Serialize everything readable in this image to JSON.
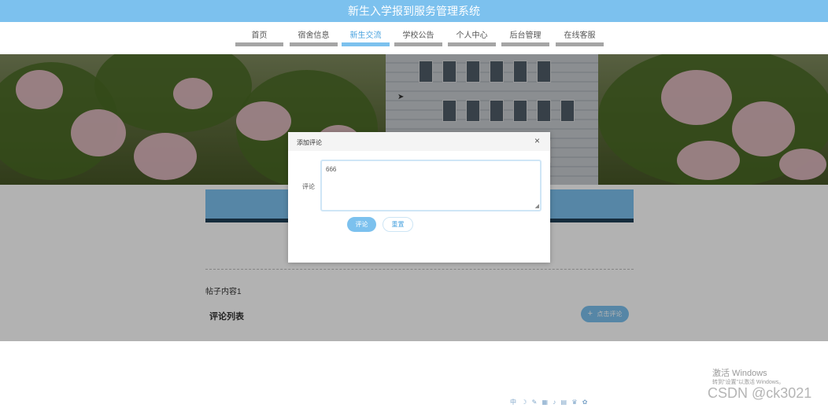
{
  "app": {
    "title": "新生入学报到服务管理系统"
  },
  "nav": {
    "items": [
      {
        "label": "首页"
      },
      {
        "label": "宿舍信息"
      },
      {
        "label": "新生交流"
      },
      {
        "label": "学校公告"
      },
      {
        "label": "个人中心"
      },
      {
        "label": "后台管理"
      },
      {
        "label": "在线客服"
      }
    ],
    "active_index": 2
  },
  "page": {
    "post_content": "帖子内容1",
    "comments_title": "评论列表",
    "add_comment_label": "点击评论",
    "add_comment_icon": "plus-icon"
  },
  "dialog": {
    "title": "添加评论",
    "close_symbol": "×",
    "field_label": "评论",
    "textarea_value": "666",
    "submit_label": "评论",
    "reset_label": "重置"
  },
  "overlay": {
    "watermark_title": "激活 Windows",
    "watermark_subtitle": "转到\"设置\"以激活 Windows。",
    "credit": "CSDN @ck3021",
    "tray": "中 ☽ ✎ ▦ ♪ ▤ ♛ ✿"
  },
  "colors": {
    "accent": "#7cc1ee",
    "nav_underline": "#a5a5a5",
    "dark_bar": "#1f3f56"
  }
}
